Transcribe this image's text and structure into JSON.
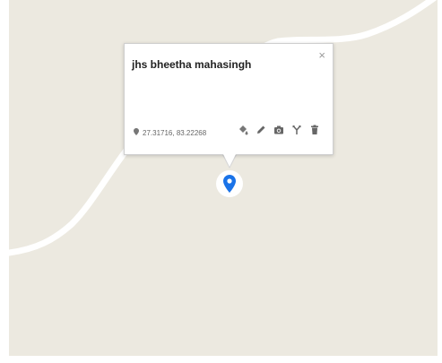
{
  "map": {
    "land_color": "#ece9e0",
    "road_color": "#ffffff"
  },
  "popup": {
    "title": "jhs bheetha mahasingh",
    "close_label": "×",
    "coordinates": "27.31716, 83.22268",
    "tools": [
      {
        "icon": "paint-bucket-icon"
      },
      {
        "icon": "pencil-icon"
      },
      {
        "icon": "camera-icon"
      },
      {
        "icon": "directions-fork-icon"
      },
      {
        "icon": "trash-icon"
      }
    ]
  },
  "marker": {
    "icon": "map-pin-icon",
    "color": "#1a73e8"
  }
}
